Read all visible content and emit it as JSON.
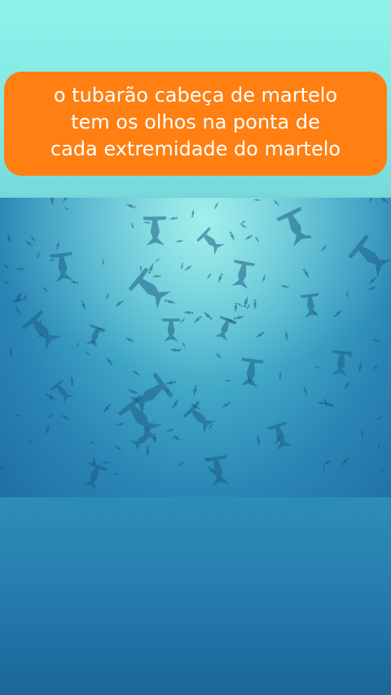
{
  "caption": {
    "line1": "o tubarão cabeça de martelo",
    "line2": "tem os olhos  na ponta  de",
    "line3": "cada extremidade  do martelo"
  },
  "colors": {
    "caption_background": "#ff7f12",
    "caption_text": "#ffffff",
    "top_water": "#8ff3ea",
    "deep_water": "#1c6699"
  },
  "media": {
    "subject_icon": "hammerhead-shark-school-icon"
  }
}
